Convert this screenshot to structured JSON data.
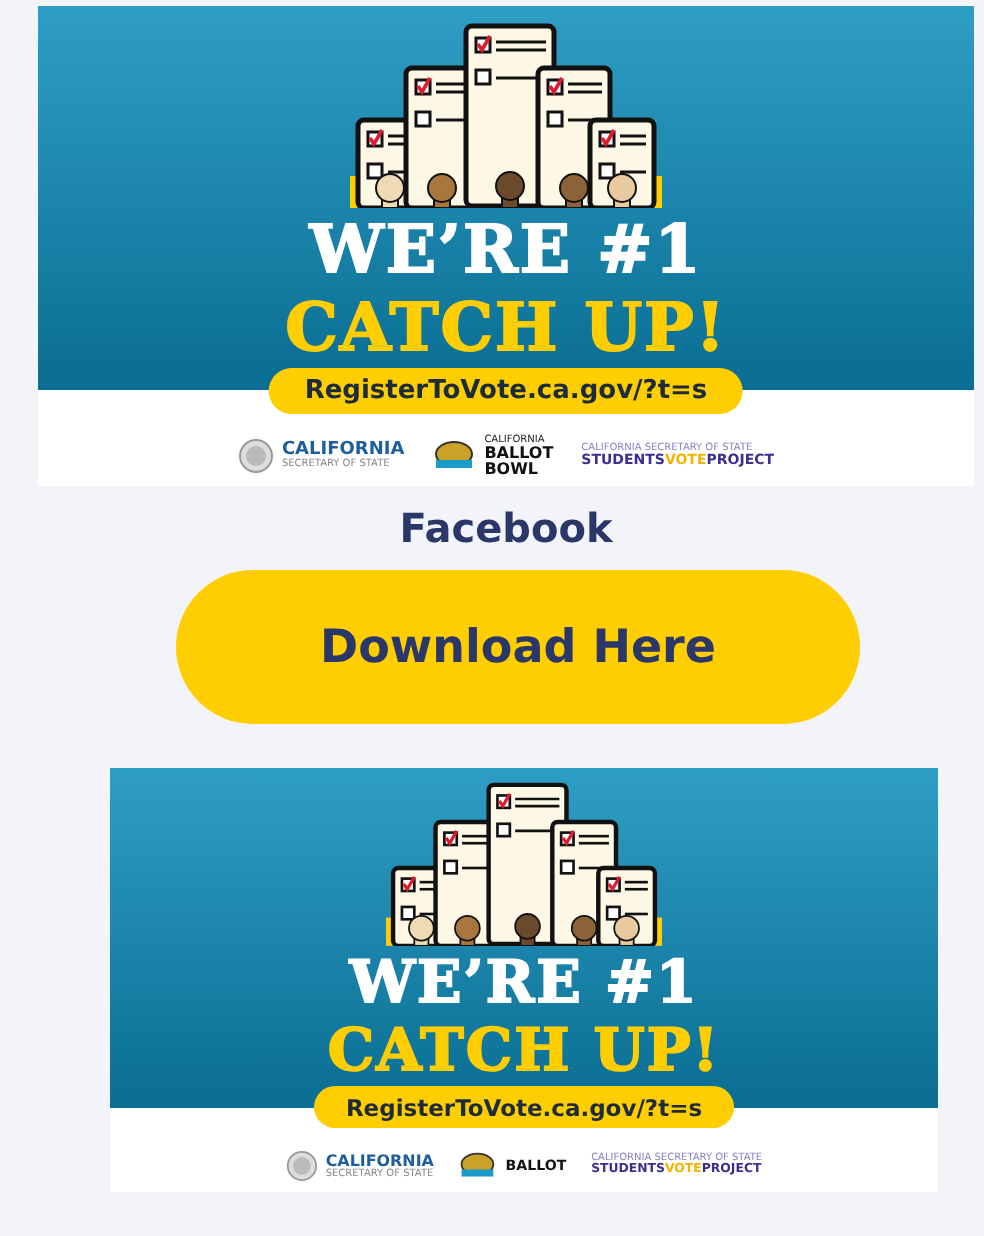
{
  "top_banner": {
    "headline": "WE’RE #1",
    "subheadline": "CATCH UP!",
    "url": "RegisterToVote.ca.gov/?t=s",
    "logos": {
      "seal_title": "CALIFORNIA",
      "seal_subtitle": "SECRETARY OF STATE",
      "bowl_top": "CALIFORNIA",
      "bowl_line_1": "BALLOT",
      "bowl_line_2": "BOWL",
      "project_top": "CALIFORNIA SECRETARY OF STATE",
      "project_parts": [
        "STUDENTS",
        "VOTE",
        "PROJECT"
      ]
    }
  },
  "heading": "Facebook",
  "download_button": "Download Here",
  "bottom_banner": {
    "headline": "WE’RE #1",
    "subheadline": "CATCH UP!",
    "url": "RegisterToVote.ca.gov/?t=s",
    "logos": {
      "seal_title": "CALIFORNIA",
      "seal_subtitle": "SECRETARY OF STATE",
      "bowl_line_1": "BALLOT",
      "project_top": "CALIFORNIA SECRETARY OF STATE",
      "project_parts": [
        "STUDENTS",
        "VOTE",
        "PROJECT"
      ]
    }
  }
}
